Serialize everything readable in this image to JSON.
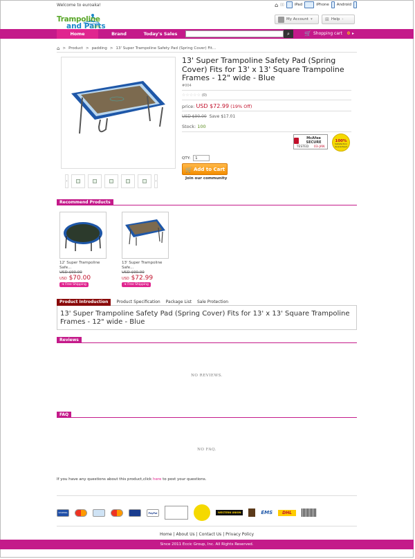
{
  "topbar": {
    "welcome": "Welcome to euroaka!",
    "devices": [
      "iPad",
      "iPhone",
      "Android"
    ]
  },
  "logo": {
    "line1": "Trampoline",
    "line2": "and Parts",
    "suffix": ".com"
  },
  "account": {
    "my_account": "My Account",
    "help": "Help"
  },
  "nav": {
    "home": "Home",
    "brand": "Brand",
    "todays_sales": "Today's Sales",
    "cart": "Shopping cart",
    "cart_count": "0"
  },
  "search": {
    "value": ""
  },
  "breadcrumb": [
    "Product",
    "padding",
    "13' Super Trampoline Safety Pad (Spring Cover) Fit..."
  ],
  "product": {
    "title": "13' Super Trampoline Safety Pad (Spring Cover) Fits for 13' x 13' Square Trampoline Frames - 12\" wide - Blue",
    "sku": "#004",
    "reviews_count": "(0)",
    "price_label": "price:",
    "price": "USD $72.99",
    "discount": "(19% Off)",
    "old_price": "USD $90.00",
    "save": "Save $17.01",
    "stock_label": "Stock:",
    "stock": "100",
    "qty_label": "QTY:",
    "qty": "1",
    "add_to_cart": "Add to Cart",
    "join": "Join our community"
  },
  "badges": {
    "mcafee": "McAfee SECURE",
    "tested": "TESTED",
    "date": "03-JAN",
    "satisfaction": "100%",
    "satisfaction_sub": "Satisfaction Guaranteed"
  },
  "recommend": {
    "heading": "Recommend Products",
    "items": [
      {
        "name": "12' Super Trampoline Safe...",
        "old": "USD $90.00",
        "currency": "USD",
        "price": "$70.00",
        "ship": "Free Shipping"
      },
      {
        "name": "13' Super Trampoline Safe...",
        "old": "USD $90.00",
        "currency": "USD",
        "price": "$72.99",
        "ship": "Free Shipping"
      }
    ]
  },
  "tabs": [
    "Product Introduction",
    "Product Specification",
    "Package List",
    "Sale Protection"
  ],
  "intro_text": "13' Super Trampoline Safety Pad (Spring Cover) Fits for 13' x 13' Square Trampoline Frames - 12\" wide - Blue",
  "reviews": {
    "heading": "Reviews",
    "empty": "NO REVIEWS."
  },
  "faq": {
    "heading": "FAQ",
    "empty": "NO FAQ."
  },
  "question": {
    "pre": "If you have any questions about this product,click ",
    "link": "here",
    "post": " to post your questions."
  },
  "payments": [
    "SHOPPING",
    "MasterCard",
    "Maestro",
    "Discover",
    "VISA",
    "PayPal",
    "McAfee SECURE",
    "PayPal VERIFIED",
    "WESTERN UNION",
    "UPS",
    "EMS",
    "DHL",
    "Barcode"
  ],
  "footer": {
    "links": [
      "Home",
      "About Us",
      "Contact Us",
      "Privacy Policy"
    ],
    "copyright": "Since 2011 Eccic Group, Inc. All Rights Reserved."
  },
  "colors": {
    "brand": "#c41a8a",
    "accent": "#e0258f",
    "price": "#c10f2a"
  }
}
